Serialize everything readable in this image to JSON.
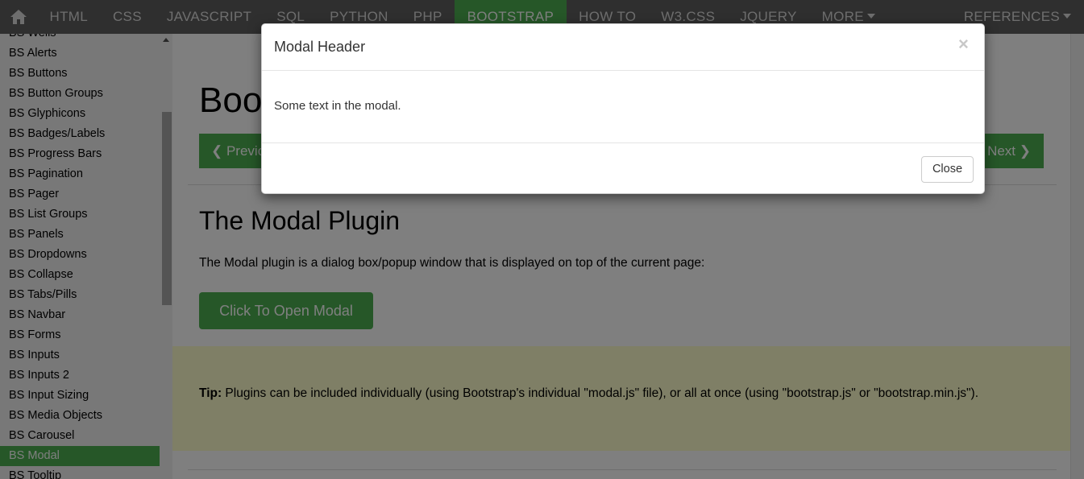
{
  "topnav": {
    "home_icon": "home-icon",
    "items": [
      "HTML",
      "CSS",
      "JAVASCRIPT",
      "SQL",
      "PYTHON",
      "PHP",
      "BOOTSTRAP",
      "HOW TO",
      "W3.CSS",
      "JQUERY"
    ],
    "active": "BOOTSTRAP",
    "more_label": "MORE",
    "references_label": "REFERENCES"
  },
  "sidebar": {
    "items": [
      "BS Wells",
      "BS Alerts",
      "BS Buttons",
      "BS Button Groups",
      "BS Glyphicons",
      "BS Badges/Labels",
      "BS Progress Bars",
      "BS Pagination",
      "BS Pager",
      "BS List Groups",
      "BS Panels",
      "BS Dropdowns",
      "BS Collapse",
      "BS Tabs/Pills",
      "BS Navbar",
      "BS Forms",
      "BS Inputs",
      "BS Inputs 2",
      "BS Input Sizing",
      "BS Media Objects",
      "BS Carousel",
      "BS Modal",
      "BS Tooltip"
    ],
    "active": "BS Modal"
  },
  "main": {
    "page_title": "Bootstrap Modal Plugin",
    "prev_label": "❮ Previous",
    "next_label": "Next ❯",
    "section_title": "The Modal Plugin",
    "paragraph": "The Modal plugin is a dialog box/popup window that is displayed on top of the current page:",
    "open_button": "Click To Open Modal",
    "tip_label": "Tip:",
    "tip_text": " Plugins can be included individually (using Bootstrap's individual \"modal.js\" file), or all at once (using \"bootstrap.js\" or \"bootstrap.min.js\")."
  },
  "modal": {
    "title": "Modal Header",
    "close_x": "×",
    "body": "Some text in the modal.",
    "close_button": "Close"
  },
  "colors": {
    "brand_green": "#4CAF50",
    "nav_dark": "#5f5f5f",
    "tip_background": "#ffffcc"
  }
}
